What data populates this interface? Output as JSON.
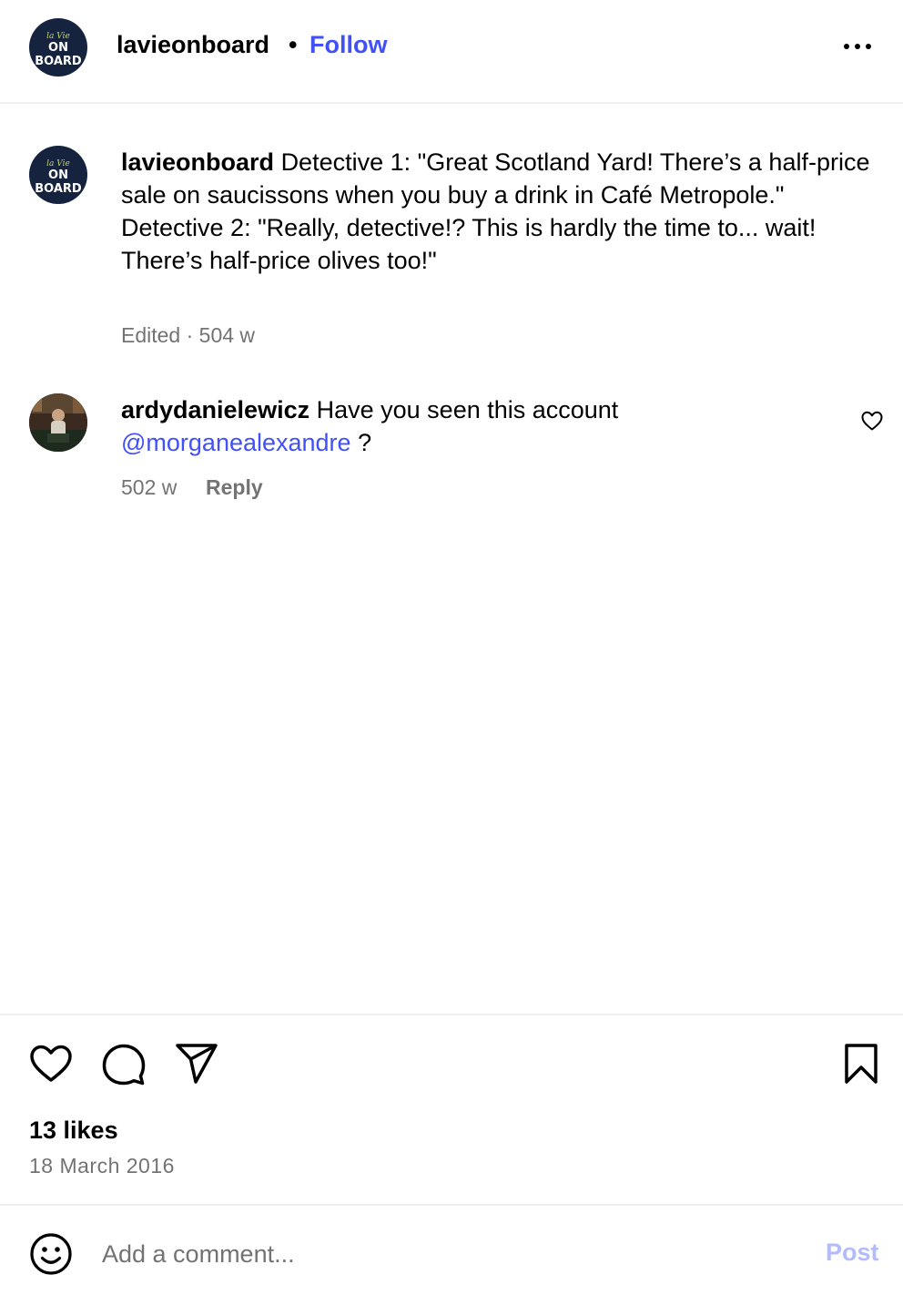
{
  "header": {
    "username": "lavieonboard",
    "separator": "•",
    "follow_label": "Follow",
    "more_icon": "more-horizontal-icon"
  },
  "brand_avatar": {
    "top_text": "la Vie",
    "main_text": "ON BOARD"
  },
  "caption": {
    "username": "lavieonboard",
    "line1": "Detective 1: \"Great Scotland Yard! There’s a half-price sale on saucissons when you buy a drink in Café Metropole.\"",
    "line2": "Detective 2: \"Really, detective!? This is hardly the time to... wait! There’s half-price olives too!\"",
    "meta": "Edited · 504 w"
  },
  "comment": {
    "username": "ardydanielewicz",
    "text": "Have you seen this account",
    "mention": "@morganealexandre",
    "suffix": " ?",
    "time": "502 w",
    "reply_label": "Reply",
    "like_icon": "heart-outline-icon"
  },
  "actions": {
    "like_icon": "heart-icon",
    "comment_icon": "speech-bubble-icon",
    "share_icon": "paper-plane-icon",
    "save_icon": "bookmark-icon"
  },
  "likes": "13 likes",
  "date": "18 March 2016",
  "add_comment": {
    "placeholder": "Add a comment...",
    "post_label": "Post",
    "emoji_icon": "smiley-icon"
  },
  "colors": {
    "link_blue": "#4150f7",
    "post_disabled": "#b2bbfc",
    "muted": "#737373",
    "divider": "#efefef",
    "brand_navy": "#15233f"
  }
}
